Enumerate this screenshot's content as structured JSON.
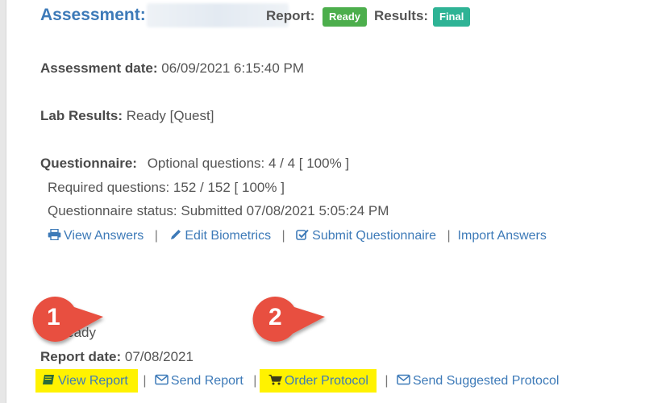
{
  "header": {
    "assessment_label": "Assessment:",
    "report_label": "Report:",
    "report_badge": "Ready",
    "results_label": "Results:",
    "results_badge": "Final"
  },
  "assessment_date": {
    "label": "Assessment date:",
    "value": "06/09/2021 6:15:40 PM"
  },
  "lab_results": {
    "label": "Lab Results:",
    "value": "Ready [Quest]"
  },
  "questionnaire": {
    "label": "Questionnaire:",
    "optional": "Optional questions: 4 / 4 [ 100% ]",
    "required": "Required questions: 152 / 152 [ 100% ]",
    "status": "Questionnaire status: Submitted 07/08/2021 5:05:24 PM",
    "links": {
      "view_answers": "View Answers",
      "edit_biometrics": "Edit Biometrics",
      "submit_questionnaire": "Submit Questionnaire",
      "import_answers": "Import Answers"
    }
  },
  "report": {
    "status_label_partial": "s:",
    "status_value": "Ready",
    "date_label": "Report date:",
    "date_value": "07/08/2021",
    "links": {
      "view_report": "View Report",
      "send_report": "Send Report",
      "order_protocol": "Order Protocol",
      "send_suggested_protocol": "Send Suggested Protocol"
    }
  },
  "callouts": {
    "one": "1",
    "two": "2"
  },
  "colors": {
    "link": "#3d7ab8",
    "badge_ready": "#4cae4c",
    "badge_final": "#2eb395",
    "highlight": "#fff200",
    "callout": "#e8503f"
  }
}
